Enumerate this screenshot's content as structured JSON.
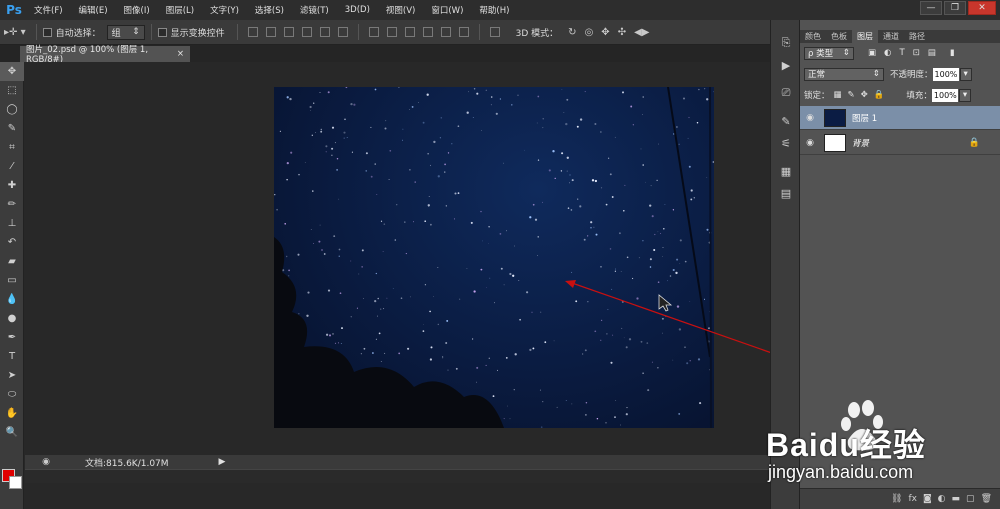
{
  "app": {
    "logo": "Ps"
  },
  "menu": [
    "文件(F)",
    "编辑(E)",
    "图像(I)",
    "图层(L)",
    "文字(Y)",
    "选择(S)",
    "滤镜(T)",
    "3D(D)",
    "视图(V)",
    "窗口(W)",
    "帮助(H)"
  ],
  "window_controls": {
    "minimize": "—",
    "restore": "❐",
    "close": "✕"
  },
  "options": {
    "auto_select_label": "自动选择：",
    "auto_select_value": "组",
    "show_transform_label": "显示变换控件",
    "mode_3d_label": "3D 模式："
  },
  "document": {
    "tab_title": "图片_02.psd @ 100% (图层 1, RGB/8#)",
    "close": "×"
  },
  "status": {
    "doc_info": "文档:815.6K/1.07M"
  },
  "panels": {
    "tabs": [
      "颜色",
      "色板",
      "图层",
      "通道",
      "路径"
    ],
    "active_tab": "图层",
    "filter_label": "ρ 类型",
    "blend_mode": "正常",
    "opacity_label": "不透明度：",
    "opacity_value": "100%",
    "lock_label": "锁定：",
    "fill_label": "填充：",
    "fill_value": "100%",
    "layers": [
      {
        "name": "图层 1",
        "selected": true,
        "thumb": "#0b1c44"
      },
      {
        "name": "背景",
        "selected": false,
        "thumb": "#ffffff",
        "locked": true
      }
    ]
  },
  "watermark": {
    "brand": "Baidu经验",
    "url": "jingyan.baidu.com"
  },
  "colors": {
    "foreground": "#e00000",
    "background": "#ffffff",
    "arrow": "#c81010"
  }
}
